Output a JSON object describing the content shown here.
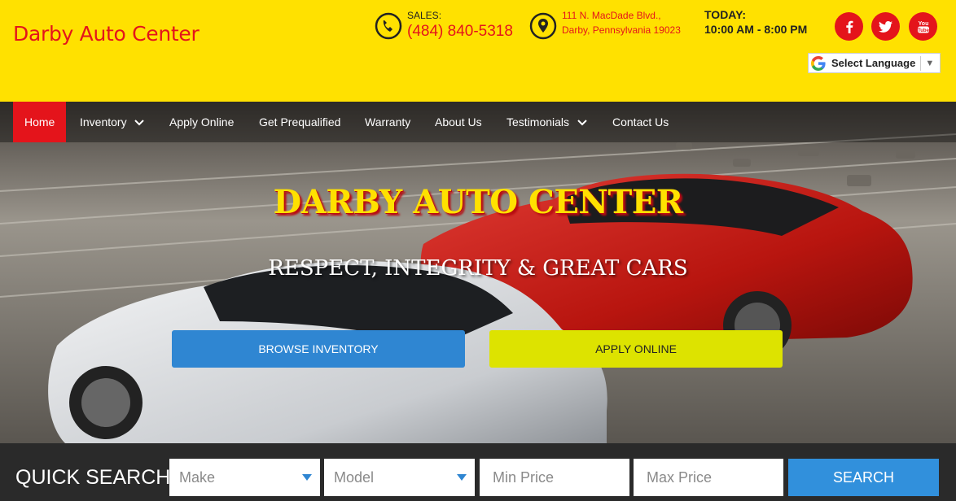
{
  "header": {
    "logo": "Darby Auto Center",
    "sales_label": "SALES:",
    "sales_phone": "(484) 840-5318",
    "address_line1": "111 N. MacDade Blvd.,",
    "address_line2": "Darby, Pennsylvania 19023",
    "today_label": "TODAY:",
    "hours": "10:00 AM - 8:00 PM",
    "social": [
      "facebook-icon",
      "twitter-icon",
      "youtube-icon"
    ],
    "language": "Select Language",
    "colors": {
      "background": "#ffe100",
      "accent": "#e4141b"
    }
  },
  "nav": {
    "items": [
      {
        "label": "Home",
        "active": true
      },
      {
        "label": "Inventory",
        "dropdown": true
      },
      {
        "label": "Apply Online"
      },
      {
        "label": "Get Prequalified"
      },
      {
        "label": "Warranty"
      },
      {
        "label": "About Us"
      },
      {
        "label": "Testimonials",
        "dropdown": true
      },
      {
        "label": "Contact Us"
      }
    ]
  },
  "hero": {
    "title": "DARBY AUTO CENTER",
    "subtitle": "RESPECT, INTEGRITY & GREAT CARS",
    "browse_button": "BROWSE INVENTORY",
    "apply_button": "APPLY ONLINE",
    "colors": {
      "browse": "#2f86d2",
      "apply": "#dde300"
    }
  },
  "quick_search": {
    "label": "QUICK SEARCH",
    "make_placeholder": "Make",
    "model_placeholder": "Model",
    "min_price_placeholder": "Min Price",
    "max_price_placeholder": "Max Price",
    "search_button": "SEARCH"
  }
}
